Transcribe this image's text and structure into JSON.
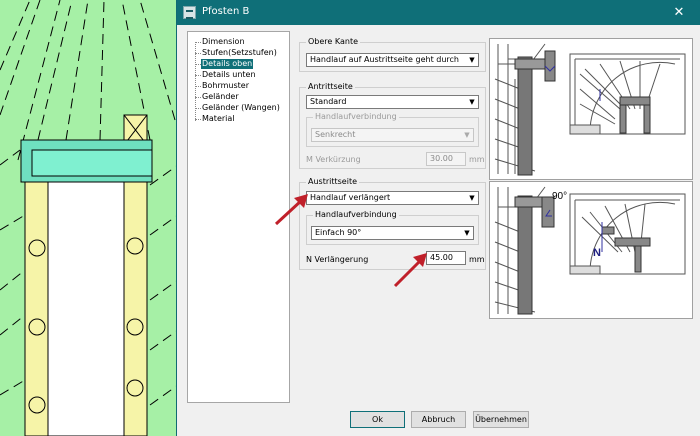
{
  "window": {
    "title": "Pfosten B",
    "close_glyph": "✕"
  },
  "tree": {
    "items": [
      {
        "label": "Dimension"
      },
      {
        "label": "Stufen(Setzstufen)"
      },
      {
        "label": "Details oben",
        "selected": true
      },
      {
        "label": "Details unten"
      },
      {
        "label": "Bohrmuster"
      },
      {
        "label": "Geländer"
      },
      {
        "label": "Geländer (Wangen)"
      },
      {
        "label": "Material"
      }
    ]
  },
  "obere_kante": {
    "title": "Obere Kante",
    "select_value": "Handlauf auf Austrittseite geht durch"
  },
  "antrittseite": {
    "title": "Antrittseite",
    "select_value": "Standard",
    "handlauf_group_title": "Handlaufverbindung",
    "handlauf_value": "Senkrecht",
    "verkuerzung_label": "M Verkürzung",
    "verkuerzung_value": "30.00",
    "verkuerzung_unit": "mm"
  },
  "austrittseite": {
    "title": "Austrittseite",
    "select_value": "Handlauf verlängert",
    "handlauf_group_title": "Handlaufverbindung",
    "handlauf_value": "Einfach 90°",
    "verlaengerung_label": "N Verlängerung",
    "verlaengerung_value": "45.00",
    "verlaengerung_unit": "mm"
  },
  "illustration": {
    "angle_label": "90°",
    "n_label": "N"
  },
  "buttons": {
    "ok": "Ok",
    "cancel": "Abbruch",
    "apply": "Übernehmen"
  },
  "colors": {
    "titlebar": "#0f6f78",
    "cad_background": "#a6f0a6",
    "annotation_arrow": "#c0202a"
  }
}
